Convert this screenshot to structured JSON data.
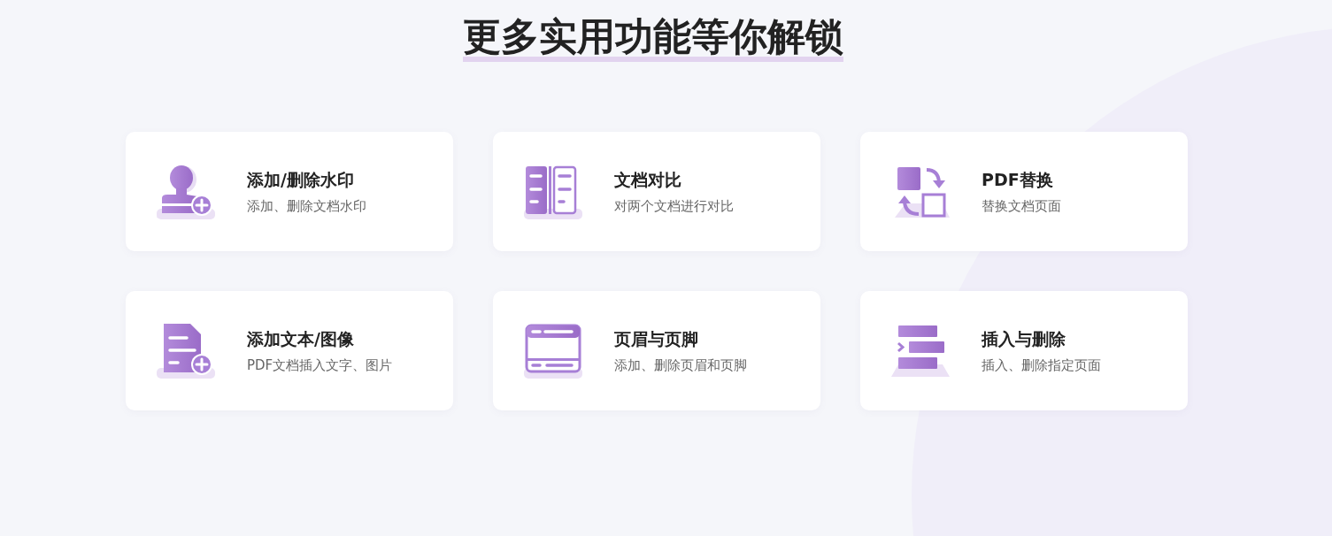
{
  "heading": "更多实用功能等你解锁",
  "features": [
    {
      "kind": "watermark",
      "title": "添加/删除水印",
      "description": "添加、删除文档水印"
    },
    {
      "kind": "compare",
      "title": "文档对比",
      "description": "对两个文档进行对比"
    },
    {
      "kind": "replace",
      "title": "PDF替换",
      "description": "替换文档页面"
    },
    {
      "kind": "add-text",
      "title": "添加文本/图像",
      "description": "PDF文档插入文字、图片"
    },
    {
      "kind": "header-footer",
      "title": "页眉与页脚",
      "description": "添加、删除页眉和页脚"
    },
    {
      "kind": "insert-delete",
      "title": "插入与删除",
      "description": "插入、删除指定页面"
    }
  ]
}
